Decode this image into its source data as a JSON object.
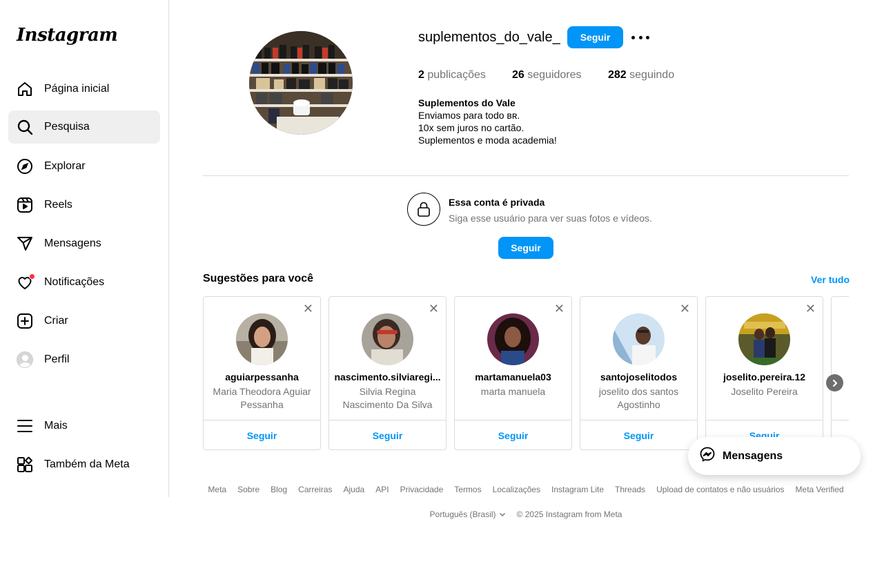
{
  "sidebar": {
    "logo": "Instagram",
    "items": [
      {
        "label": "Página inicial",
        "icon": "home-icon"
      },
      {
        "label": "Pesquisa",
        "icon": "search-icon"
      },
      {
        "label": "Explorar",
        "icon": "compass-icon"
      },
      {
        "label": "Reels",
        "icon": "reels-icon"
      },
      {
        "label": "Mensagens",
        "icon": "send-icon"
      },
      {
        "label": "Notificações",
        "icon": "heart-icon"
      },
      {
        "label": "Criar",
        "icon": "plus-square-icon"
      },
      {
        "label": "Perfil",
        "icon": "avatar"
      },
      {
        "label": "Mais",
        "icon": "menu-icon"
      },
      {
        "label": "Também da Meta",
        "icon": "grid-icon"
      }
    ]
  },
  "profile": {
    "username": "suplementos_do_vale_",
    "follow_label": "Seguir",
    "posts_count": "2",
    "posts_label": "publicações",
    "followers_count": "26",
    "followers_label": "seguidores",
    "following_count": "282",
    "following_label": "seguindo",
    "bio_name": "Suplementos do Vale",
    "bio_lines": [
      "Enviamos para todo ʙʀ.",
      "10x sem juros no cartão.",
      "Suplementos e moda academia!"
    ]
  },
  "private": {
    "title": "Essa conta é privada",
    "subtitle": "Siga esse usuário para ver suas fotos e vídeos.",
    "follow_label": "Seguir"
  },
  "suggestions": {
    "title": "Sugestões para você",
    "see_all": "Ver tudo",
    "follow_label": "Seguir",
    "cards": [
      {
        "username": "aguiarpessanha",
        "full_name": "Maria Theodora Aguiar Pessanha"
      },
      {
        "username": "nascimento.silviaregi...",
        "full_name": "Silvia Regina Nascimento Da Silva"
      },
      {
        "username": "martamanuela03",
        "full_name": "marta manuela"
      },
      {
        "username": "santojoselitodos",
        "full_name": "joselito dos santos Agostinho"
      },
      {
        "username": "joselito.pereira.12",
        "full_name": "Joselito Pereira"
      }
    ]
  },
  "messages_float": {
    "label": "Mensagens"
  },
  "footer": {
    "links": [
      "Meta",
      "Sobre",
      "Blog",
      "Carreiras",
      "Ajuda",
      "API",
      "Privacidade",
      "Termos",
      "Localizações",
      "Instagram Lite",
      "Threads",
      "Upload de contatos e não usuários",
      "Meta Verified"
    ],
    "language": "Português (Brasil)",
    "copyright": "© 2025 Instagram from Meta"
  },
  "colors": {
    "accent": "#0095f6",
    "notification": "#ff3040",
    "muted": "#737373",
    "border": "#dbdbdb"
  }
}
